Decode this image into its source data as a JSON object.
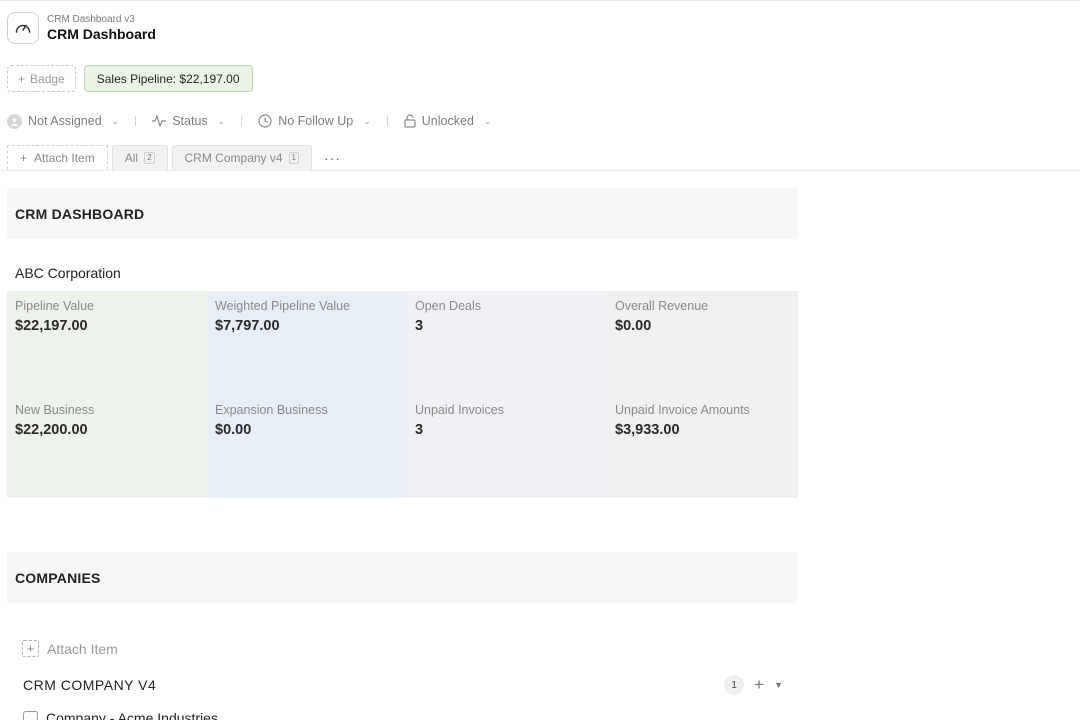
{
  "header": {
    "subtitle": "CRM Dashboard v3",
    "title": "CRM Dashboard",
    "icon": "gauge-icon"
  },
  "badges": {
    "add_label": "Badge",
    "pipeline_label": "Sales Pipeline: $22,197.00"
  },
  "properties": {
    "assignee": "Not Assigned",
    "status": "Status",
    "follow_up": "No Follow Up",
    "lock": "Unlocked"
  },
  "tabs": {
    "attach_label": "Attach Item",
    "items": [
      {
        "label": "All",
        "count": "2"
      },
      {
        "label": "CRM Company v4",
        "count": "1"
      }
    ],
    "more": "···"
  },
  "dashboard": {
    "section_title": "CRM DASHBOARD",
    "company": "ABC Corporation",
    "metrics": [
      {
        "label": "Pipeline Value",
        "value": "$22,197.00"
      },
      {
        "label": "Weighted Pipeline Value",
        "value": "$7,797.00"
      },
      {
        "label": "Open Deals",
        "value": "3"
      },
      {
        "label": "Overall Revenue",
        "value": "$0.00"
      },
      {
        "label": "New Business",
        "value": "$22,200.00"
      },
      {
        "label": "Expansion Business",
        "value": "$0.00"
      },
      {
        "label": "Unpaid Invoices",
        "value": "3"
      },
      {
        "label": "Unpaid Invoice Amounts",
        "value": "$3,933.00"
      }
    ],
    "colors": {
      "green": "#edf2ea",
      "blue": "#e7eef6",
      "lavender": "#f1f0f4",
      "grey": "#f0f0ee",
      "pipeline_badge": "#eaf3e6"
    }
  },
  "companies": {
    "section_title": "COMPANIES",
    "attach_label": "Attach Item",
    "group_title": "CRM COMPANY V4",
    "group_count": "1",
    "first_item": "Company - Acme Industries"
  }
}
